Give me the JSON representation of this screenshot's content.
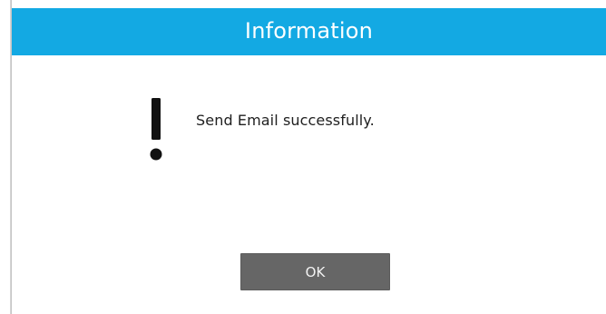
{
  "dialog": {
    "title": "Information",
    "message": "Send Email successfully.",
    "icon": "exclamation-icon",
    "ok_label": "OK"
  },
  "colors": {
    "titlebar": "#13a9e3",
    "button": "#666666",
    "text": "#202020"
  }
}
